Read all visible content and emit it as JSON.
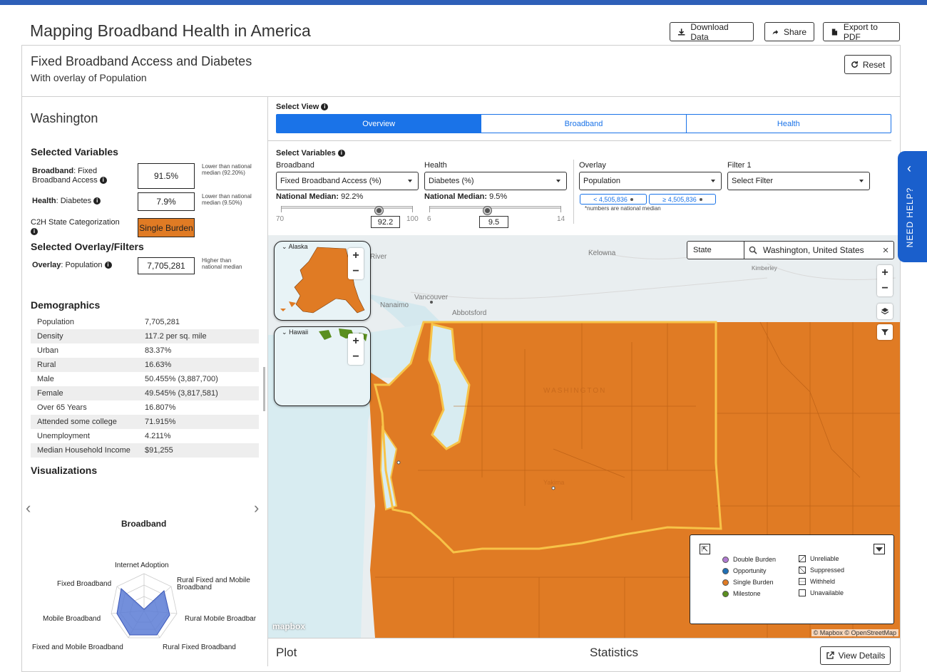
{
  "header": {
    "title": "Mapping Broadband Health in America",
    "download_label": "Download Data",
    "share_label": "Share",
    "export_label": "Export to PDF"
  },
  "subheader": {
    "title": "Fixed Broadband Access and Diabetes",
    "subtitle": "With overlay of Population",
    "reset_label": "Reset"
  },
  "left": {
    "state": "Washington",
    "selected_variables_heading": "Selected Variables",
    "broadband_prefix": "Broadband",
    "broadband_label": ": Fixed Broadband Access",
    "broadband_value": "91.5%",
    "broadband_note": "Lower than national median (92.20%)",
    "health_prefix": "Health",
    "health_label": ": Diabetes",
    "health_value": "7.9%",
    "health_note": "Lower than national median (9.50%)",
    "c2h_label": "C2H State Categorization",
    "c2h_value": "Single Burden",
    "overlay_heading": "Selected Overlay/Filters",
    "overlay_prefix": "Overlay",
    "overlay_label": ": Population",
    "overlay_value": "7,705,281",
    "overlay_note": "Higher than national median",
    "demographics_heading": "Demographics",
    "demographics": [
      {
        "k": "Population",
        "v": "7,705,281"
      },
      {
        "k": "Density",
        "v": "117.2 per sq. mile"
      },
      {
        "k": "Urban",
        "v": "83.37%"
      },
      {
        "k": "Rural",
        "v": "16.63%"
      },
      {
        "k": "Male",
        "v": "50.455% (3,887,700)"
      },
      {
        "k": "Female",
        "v": "49.545% (3,817,581)"
      },
      {
        "k": "Over 65 Years",
        "v": "16.807%"
      },
      {
        "k": "Attended some college",
        "v": "71.915%"
      },
      {
        "k": "Unemployment",
        "v": "4.211%"
      },
      {
        "k": "Median Household Income",
        "v": "$91,255"
      }
    ],
    "visualizations_heading": "Visualizations",
    "radar_title": "Broadband",
    "radar_labels": {
      "internet_adoption": "Internet Adoption",
      "rural_fixed_mobile": "Rural Fixed and Mobile Broadband",
      "rural_mobile": "Rural Mobile Broadbar",
      "rural_fixed": "Rural Fixed Broadband",
      "fixed_and_mobile": "Fixed and Mobile Broadband",
      "mobile": "Mobile Broadband",
      "fixed": "Fixed Broadband"
    }
  },
  "right": {
    "select_view_label": "Select View",
    "tabs": [
      "Overview",
      "Broadband",
      "Health"
    ],
    "select_variables_label": "Select Variables",
    "broadband_field_label": "Broadband",
    "broadband_select": "Fixed Broadband Access (%)",
    "broadband_median_label": "National Median:",
    "broadband_median": "92.2%",
    "broadband_slider": {
      "min": "70",
      "max": "100",
      "value": "92.2"
    },
    "health_field_label": "Health",
    "health_select": "Diabetes (%)",
    "health_median_label": "National Median:",
    "health_median": "9.5%",
    "health_slider": {
      "min": "6",
      "max": "14",
      "value": "9.5"
    },
    "overlay_field_label": "Overlay",
    "overlay_select": "Population",
    "overlay_pill_low": "< 4,505,836",
    "overlay_pill_high": "≥ 4,505,836",
    "overlay_footnote": "*numbers are national median",
    "filter_field_label": "Filter 1",
    "filter_select": "Select Filter",
    "need_help": "NEED HELP?"
  },
  "map": {
    "search_scope": "State",
    "search_value": "Washington, United States",
    "inset_alaska": "Alaska",
    "inset_hawaii": "Hawaii",
    "places": {
      "kelowna": "Kelowna",
      "vancouver": "Vancouver",
      "abbotsford": "Abbotsford",
      "nanaimo": "Nanaimo",
      "kimberley": "Kimberley",
      "river": "River",
      "washington": "WASHINGTON",
      "yakima": "Yakima"
    },
    "attribution": "© Mapbox © OpenStreetMap",
    "mapbox_logo": "mapbox",
    "legend": {
      "double_burden": "Double Burden",
      "opportunity": "Opportunity",
      "single_burden": "Single Burden",
      "milestone": "Milestone",
      "unreliable": "Unreliable",
      "suppressed": "Suppressed",
      "withheld": "Withheld",
      "unavailable": "Unavailable"
    },
    "colors": {
      "single_burden": "#e07b24",
      "double_burden": "#b07ad1",
      "opportunity": "#1f6fb5",
      "milestone": "#5a8f1e",
      "state_outline": "#f7c348"
    }
  },
  "bottom": {
    "plot_label": "Plot",
    "statistics_label": "Statistics",
    "view_details_label": "View Details"
  }
}
